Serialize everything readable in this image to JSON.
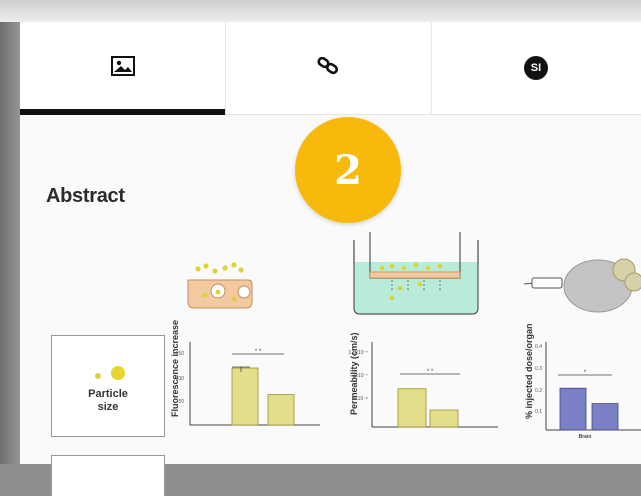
{
  "tabs": [
    {
      "name": "figures",
      "icon": "image-icon"
    },
    {
      "name": "links",
      "icon": "link-icon"
    },
    {
      "name": "supporting-info",
      "icon": "si-badge-icon",
      "badge_text": "SI"
    }
  ],
  "active_tab_index": 0,
  "step_badge": {
    "number": "2",
    "color": "#f6b90c"
  },
  "abstract": {
    "heading": "Abstract",
    "legend_label": "Particle\nsize",
    "panels": [
      {
        "ylabel": "Fluorescence increase",
        "yticks": [
          "150",
          "100",
          "50"
        ],
        "significance": "* *",
        "bars": [
          {
            "value": 103,
            "color": "#e3de8a"
          },
          {
            "value": 55,
            "color": "#e3de8a"
          }
        ],
        "ymax": 150
      },
      {
        "ylabel": "Permeability (cm/s)",
        "yticks": [
          "1.5x10⁻⁷",
          "1x10⁻⁷",
          "5x10⁻⁸"
        ],
        "significance": "* *",
        "bars": [
          {
            "value": 0.72,
            "color": "#e3de8a"
          },
          {
            "value": 0.32,
            "color": "#e3de8a"
          }
        ],
        "ymax": 1.6
      },
      {
        "ylabel": "% injected dose/organ",
        "yticks": [
          "0.4",
          "0.3",
          "0.2",
          "0.1"
        ],
        "significance": "*",
        "xlabel": "Brain",
        "bars": [
          {
            "value": 0.19,
            "color": "#7b80c4"
          },
          {
            "value": 0.12,
            "color": "#7b80c4"
          }
        ],
        "ymax": 0.4
      }
    ],
    "colors": {
      "particle": "#d9d43a",
      "cell_fill": "#f3c9a0",
      "transwell_fill": "#b8ecd8",
      "mouse": "#c4c4c4"
    }
  }
}
